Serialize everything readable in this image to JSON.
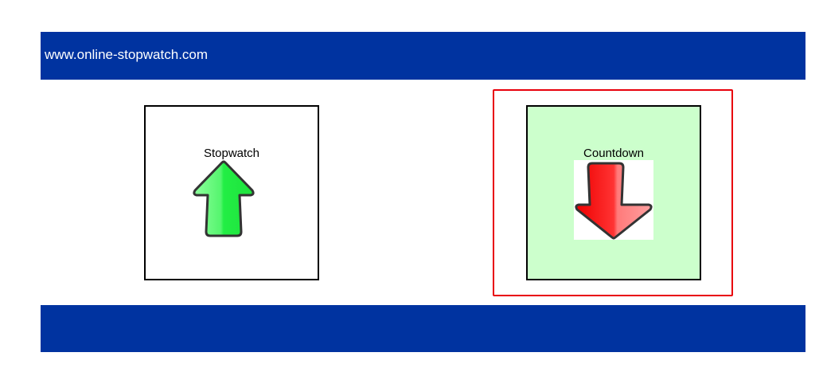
{
  "header": {
    "site_title": "www.online-stopwatch.com",
    "background_color": "#0033a0"
  },
  "tiles": [
    {
      "label": "Stopwatch",
      "icon": "up-arrow-icon",
      "icon_color": "#22ee44",
      "background_color": "#ffffff",
      "selected": false
    },
    {
      "label": "Countdown",
      "icon": "down-arrow-icon",
      "icon_color": "#ff2222",
      "background_color": "#ccffcc",
      "selected": true
    }
  ],
  "selection_color": "#e8000b",
  "footer": {
    "background_color": "#0033a0"
  }
}
